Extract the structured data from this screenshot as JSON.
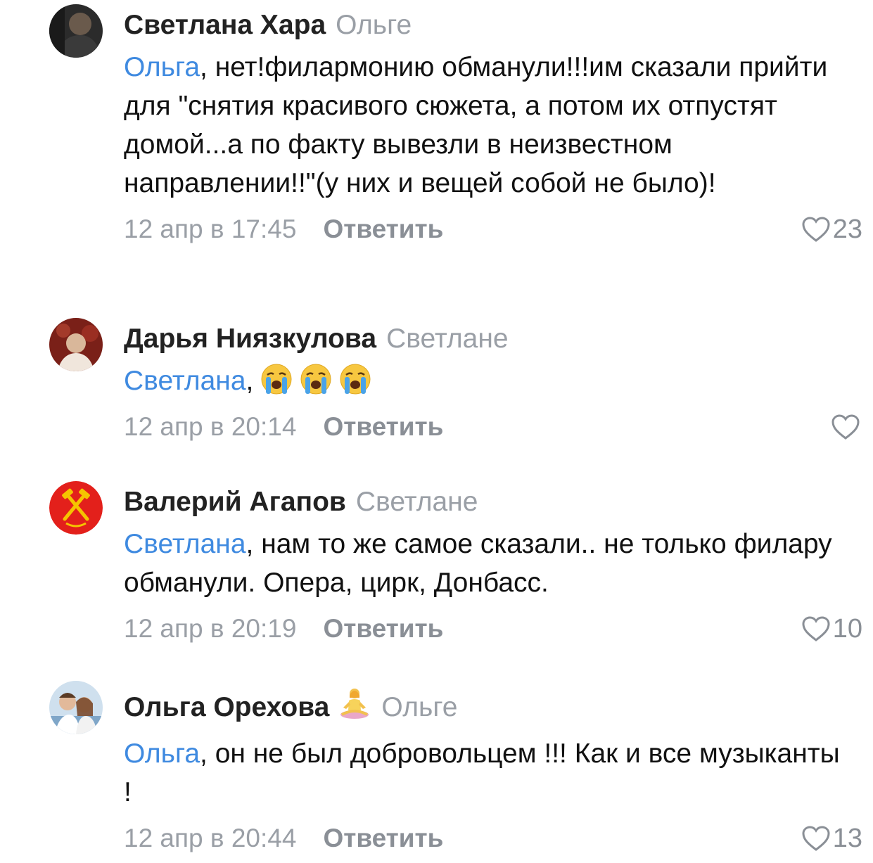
{
  "comments": [
    {
      "author": "Светлана Хара",
      "reply_to": "Ольге",
      "mention": "Ольга",
      "text": ", нет!филармонию обманули!!!им сказали прийти для \"снятия красивого сюжета, а потом их отпустят домой...а по факту вывезли в неизвестном направлении!!\"(у них и вещей собой не было)!",
      "time": "12 апр в 17:45",
      "reply_label": "Ответить",
      "likes": "23"
    },
    {
      "author": "Дарья Ниязкулова",
      "reply_to": "Светлане",
      "mention": "Светлана",
      "text": ",",
      "emojis": [
        "crying-face",
        "crying-face",
        "crying-face"
      ],
      "time": "12 апр в 20:14",
      "reply_label": "Ответить",
      "likes": ""
    },
    {
      "author": "Валерий Агапов",
      "reply_to": "Светлане",
      "mention": "Светлана",
      "text": ", нам то же самое сказали.. не только филару обманули. Опера, цирк, Донбасс.",
      "time": "12 апр в 20:19",
      "reply_label": "Ответить",
      "likes": "10"
    },
    {
      "author": "Ольга Орехова",
      "author_status_icon": "meditating-woman",
      "reply_to": "Ольге",
      "mention": "Ольга",
      "text": ", он не был добровольцем !!! Как и все музыканты !",
      "time": "12 апр в 20:44",
      "reply_label": "Ответить",
      "likes": "13"
    }
  ],
  "colors": {
    "link": "#3f8ae0",
    "secondary": "#9a9fa6",
    "author": "#222222"
  },
  "icons": {
    "like": "heart-outline-icon",
    "avatar_3": "hammer-emblem"
  }
}
